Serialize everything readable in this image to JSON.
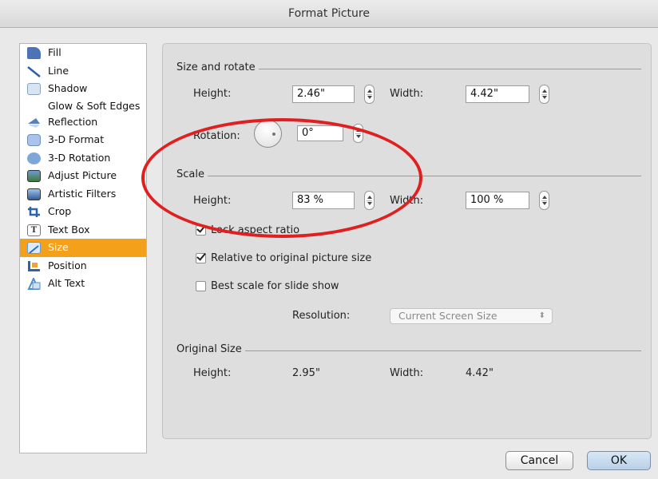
{
  "window": {
    "title": "Format Picture"
  },
  "sidebar": {
    "items": [
      {
        "label": "Fill",
        "icon": "paint-bucket-icon",
        "color": "#4a74b5"
      },
      {
        "label": "Line",
        "icon": "line-icon",
        "color": "#2e5fa8"
      },
      {
        "label": "Shadow",
        "icon": "shadow-icon",
        "color": "#d8e4f2"
      },
      {
        "label": "Glow & Soft Edges",
        "icon": "glow-icon",
        "color": "#8a5bd0"
      },
      {
        "label": "Reflection",
        "icon": "reflection-icon",
        "color": "#5a80b8"
      },
      {
        "label": "3-D Format",
        "icon": "3d-format-icon",
        "color": "#a9c4e8"
      },
      {
        "label": "3-D Rotation",
        "icon": "3d-rotation-icon",
        "color": "#7fa6d8"
      },
      {
        "label": "Adjust Picture",
        "icon": "adjust-picture-icon",
        "color": "#3f7a3a"
      },
      {
        "label": "Artistic Filters",
        "icon": "artistic-filters-icon",
        "color": "#2f5d9a"
      },
      {
        "label": "Crop",
        "icon": "crop-icon",
        "color": "#2a64b0"
      },
      {
        "label": "Text Box",
        "icon": "text-box-icon",
        "color": "#9a9a9a"
      },
      {
        "label": "Size",
        "icon": "size-icon",
        "color": "#5aa0e0",
        "selected": true
      },
      {
        "label": "Position",
        "icon": "position-icon",
        "color": "#e9a640"
      },
      {
        "label": "Alt Text",
        "icon": "alt-text-icon",
        "color": "#4f8dc9"
      }
    ]
  },
  "size_rotate": {
    "header": "Size and rotate",
    "height_label": "Height:",
    "height_value": "2.46\"",
    "width_label": "Width:",
    "width_value": "4.42\"",
    "rotation_label": "Rotation:",
    "rotation_value": "0°"
  },
  "scale": {
    "header": "Scale",
    "height_label": "Height:",
    "height_value": "83 %",
    "width_label": "Width:",
    "width_value": "100 %",
    "lock_aspect_label": "Lock aspect ratio",
    "lock_aspect_checked": true,
    "relative_label": "Relative to original picture size",
    "relative_checked": true,
    "best_scale_label": "Best scale for slide show",
    "best_scale_checked": false,
    "resolution_label": "Resolution:",
    "resolution_value": "Current Screen Size"
  },
  "original_size": {
    "header": "Original Size",
    "height_label": "Height:",
    "height_value": "2.95\"",
    "width_label": "Width:",
    "width_value": "4.42\""
  },
  "buttons": {
    "cancel": "Cancel",
    "ok": "OK"
  },
  "colors": {
    "selection": "#f5a01a",
    "annotation": "#e02020"
  }
}
